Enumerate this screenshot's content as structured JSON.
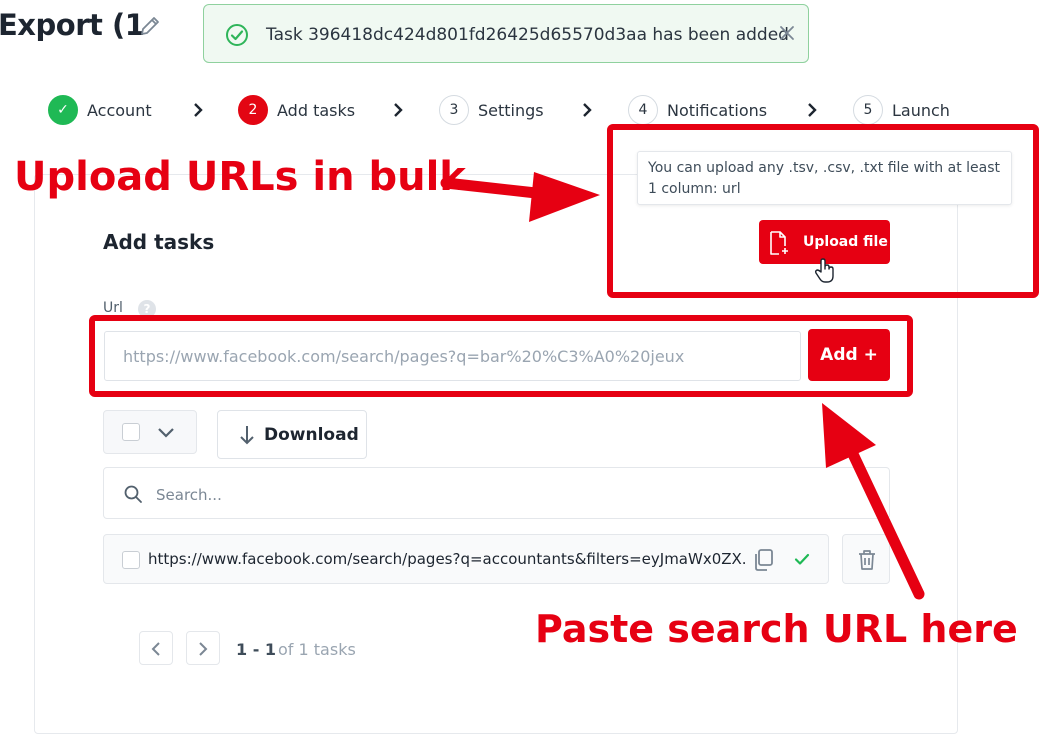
{
  "header": {
    "title": "Export (1"
  },
  "toast": {
    "message": "Task 396418dc424d801fd26425d65570d3aa has been added"
  },
  "stepper": {
    "steps": [
      {
        "number": "✓",
        "label": "Account",
        "state": "done"
      },
      {
        "number": "2",
        "label": "Add tasks",
        "state": "active"
      },
      {
        "number": "3",
        "label": "Settings",
        "state": "pending"
      },
      {
        "number": "4",
        "label": "Notifications",
        "state": "pending"
      },
      {
        "number": "5",
        "label": "Launch",
        "state": "pending"
      }
    ]
  },
  "upload": {
    "tooltip": "You can upload any .tsv, .csv, .txt file with at least 1 column: url",
    "button_label": "Upload file"
  },
  "section": {
    "title": "Add tasks"
  },
  "url_field": {
    "label": "Url",
    "help": "?",
    "placeholder": "https://www.facebook.com/search/pages?q=bar%20%C3%A0%20jeux"
  },
  "add_button": {
    "label": "Add +"
  },
  "toolbar": {
    "download_label": "Download"
  },
  "search": {
    "placeholder": "Search..."
  },
  "tasks": [
    {
      "url": "https://www.facebook.com/search/pages?q=accountants&filters=eyJmaWx0ZX."
    }
  ],
  "pagination": {
    "range": "1 - 1",
    "total": "of 1 tasks"
  },
  "annotations": {
    "upload_label": "Upload URLs in bulk",
    "paste_label": "Paste search URL here"
  },
  "colors": {
    "brand_red": "#e60012",
    "success_green": "#1fb955"
  }
}
